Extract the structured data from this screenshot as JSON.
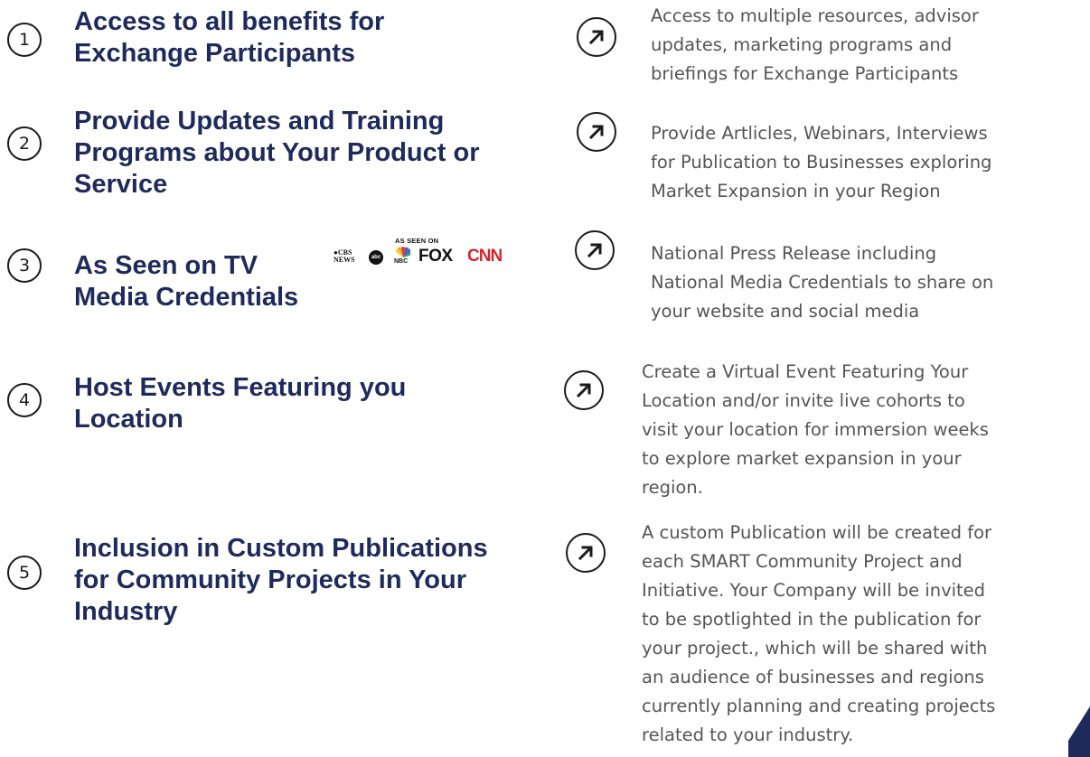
{
  "items": [
    {
      "number": "1",
      "title_lines": [
        "Access to all benefits for",
        "Exchange Participants"
      ],
      "description_lines": [
        "Access to multiple resources, advisor",
        "updates, marketing programs and",
        "briefings  for Exchange Participants"
      ]
    },
    {
      "number": "2",
      "title_lines": [
        "Provide Updates and Training",
        "Programs about Your Product or",
        "Service"
      ],
      "description_lines": [
        "Provide Artlicles, Webinars, Interviews",
        "for Publication to Businesses exploring",
        "Market Expansion in your Region"
      ]
    },
    {
      "number": "3",
      "title_lines": [
        "As Seen on TV",
        "Media Credentials"
      ],
      "description_lines": [
        "National Press Release including",
        "National Media Credentials to share on",
        "your website and social media"
      ]
    },
    {
      "number": "4",
      "title_lines": [
        "Host Events Featuring you",
        "Location"
      ],
      "description_lines": [
        "Create a Virtual Event Featuring Your",
        "Location and/or invite live cohorts to",
        "visit your location  for immersion weeks",
        "to explore market expansion in your",
        "region."
      ]
    },
    {
      "number": "5",
      "title_lines": [
        "Inclusion in Custom Publications",
        "for Community Projects in Your",
        "Industry"
      ],
      "description_lines": [
        "A custom Publication will be created for",
        "each SMART Community Project and",
        "Initiative.  Your Company will be invited",
        "to be spotlighted in the publication for",
        "your project., which will be shared with",
        "an audience of businesses and regions",
        "currently planning and creating projects",
        "related to your industry."
      ]
    }
  ],
  "media_logos": {
    "heading": "AS SEEN ON",
    "cbs": "CBS NEWS",
    "abc": "abc",
    "nbc": "NBC",
    "fox": "FOX",
    "cnn": "CNN"
  },
  "colors": {
    "title": "#1f2a5c",
    "description": "#555555",
    "circle_border": "#1a1a1a",
    "corner_accent": "#1f2a5c"
  },
  "icons": {
    "row_marker": "arrow-up-right-icon"
  }
}
